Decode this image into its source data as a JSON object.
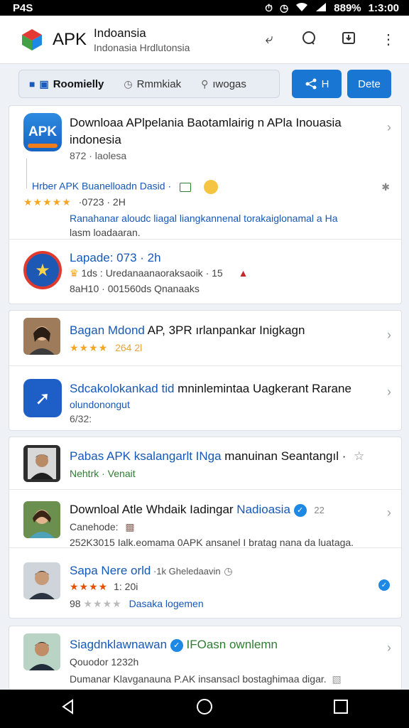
{
  "status_bar": {
    "carrier": "P4S",
    "battery": "889%",
    "time": "1:3:00",
    "icons": [
      "alarm-icon",
      "clock-icon",
      "wifi-icon",
      "signal-icon"
    ]
  },
  "app_bar": {
    "app_name": "APK",
    "title": "Indoansia",
    "subtitle": "Indonasia Hrdlutonsia",
    "actions": [
      "back-arrow-icon",
      "search-icon",
      "download-icon",
      "more-vert-icon"
    ]
  },
  "filters": {
    "chips": [
      {
        "label": "Roomielly",
        "icon": "bookmark-icon"
      },
      {
        "label": "Rmmkiak",
        "icon": "clock-icon"
      },
      {
        "label": "ıwogas",
        "icon": "search-icon"
      }
    ],
    "share_label": "H",
    "dete_label": "Dete"
  },
  "card1": {
    "item1": {
      "icon_text": "APK",
      "title_line1": "Downloaa APlpelania Baotamlairig n APla Inouasia",
      "title_line2": "indonesia",
      "sub": "872 · laolesa",
      "link_line": "Hrber APK Buanelloadn Dasid ·",
      "rating_stars": "★★★★★",
      "rating_text": "·0723 · 2H",
      "desc_line1": "Ranahanar aloudc liagal liangkannenal torakaiglonamal a Ha",
      "desc_line2": "lasm loadaaran."
    },
    "item2": {
      "title": "Lapade: 073 · 2h",
      "meta_line": "1ds : Uredanaanaoraksaoik · 15",
      "stats": "8aH10 · 001560ds Qnanaaks"
    }
  },
  "card2": {
    "item1": {
      "title_a": "Bagan Mdond",
      "title_b": " AP, 3PR ırlanpankar Inigkagn",
      "stars": "★★★★",
      "rating": "264 2l"
    },
    "item2": {
      "title_a": "Sdcakolokankad tid",
      "title_b": " mninlemintaa Uagkerant Rarane",
      "sub": "olundonongut",
      "meta": "6/32:"
    }
  },
  "card3": {
    "item1": {
      "title_a": "Pabas APK ksalangarlt INga",
      "title_b": " manuinan Seantangıl ·",
      "sub": "Nehtrk · Venait"
    },
    "item2": {
      "title_a": "Downloal Atle Whdaik Iadingar ",
      "title_b": "Nadioasia",
      "badge_num": "22",
      "meta": "Canehode:",
      "desc": "252K3015 Ialk.eomama 0APK ansanel I bratag nana da luataga."
    },
    "item3": {
      "title_a": "Sapa Nere orld",
      "title_b": " ·1k Gheledaavin",
      "stars": "★★★★",
      "rating": "1: 20i",
      "stars_gray": "★★★★",
      "sub_prefix": "98",
      "sub": "Dasaka logemen"
    }
  },
  "card4": {
    "item1": {
      "title_a": "Siagdnklawnawan",
      "title_b": " IFOasn ownlemn",
      "meta": "Qouodor 1232h",
      "desc": "Dumanar Klavganauna P.AK insansacl bostaghimaa digar."
    }
  },
  "nav": [
    "back-triangle-icon",
    "home-circle-icon",
    "recents-square-icon"
  ]
}
